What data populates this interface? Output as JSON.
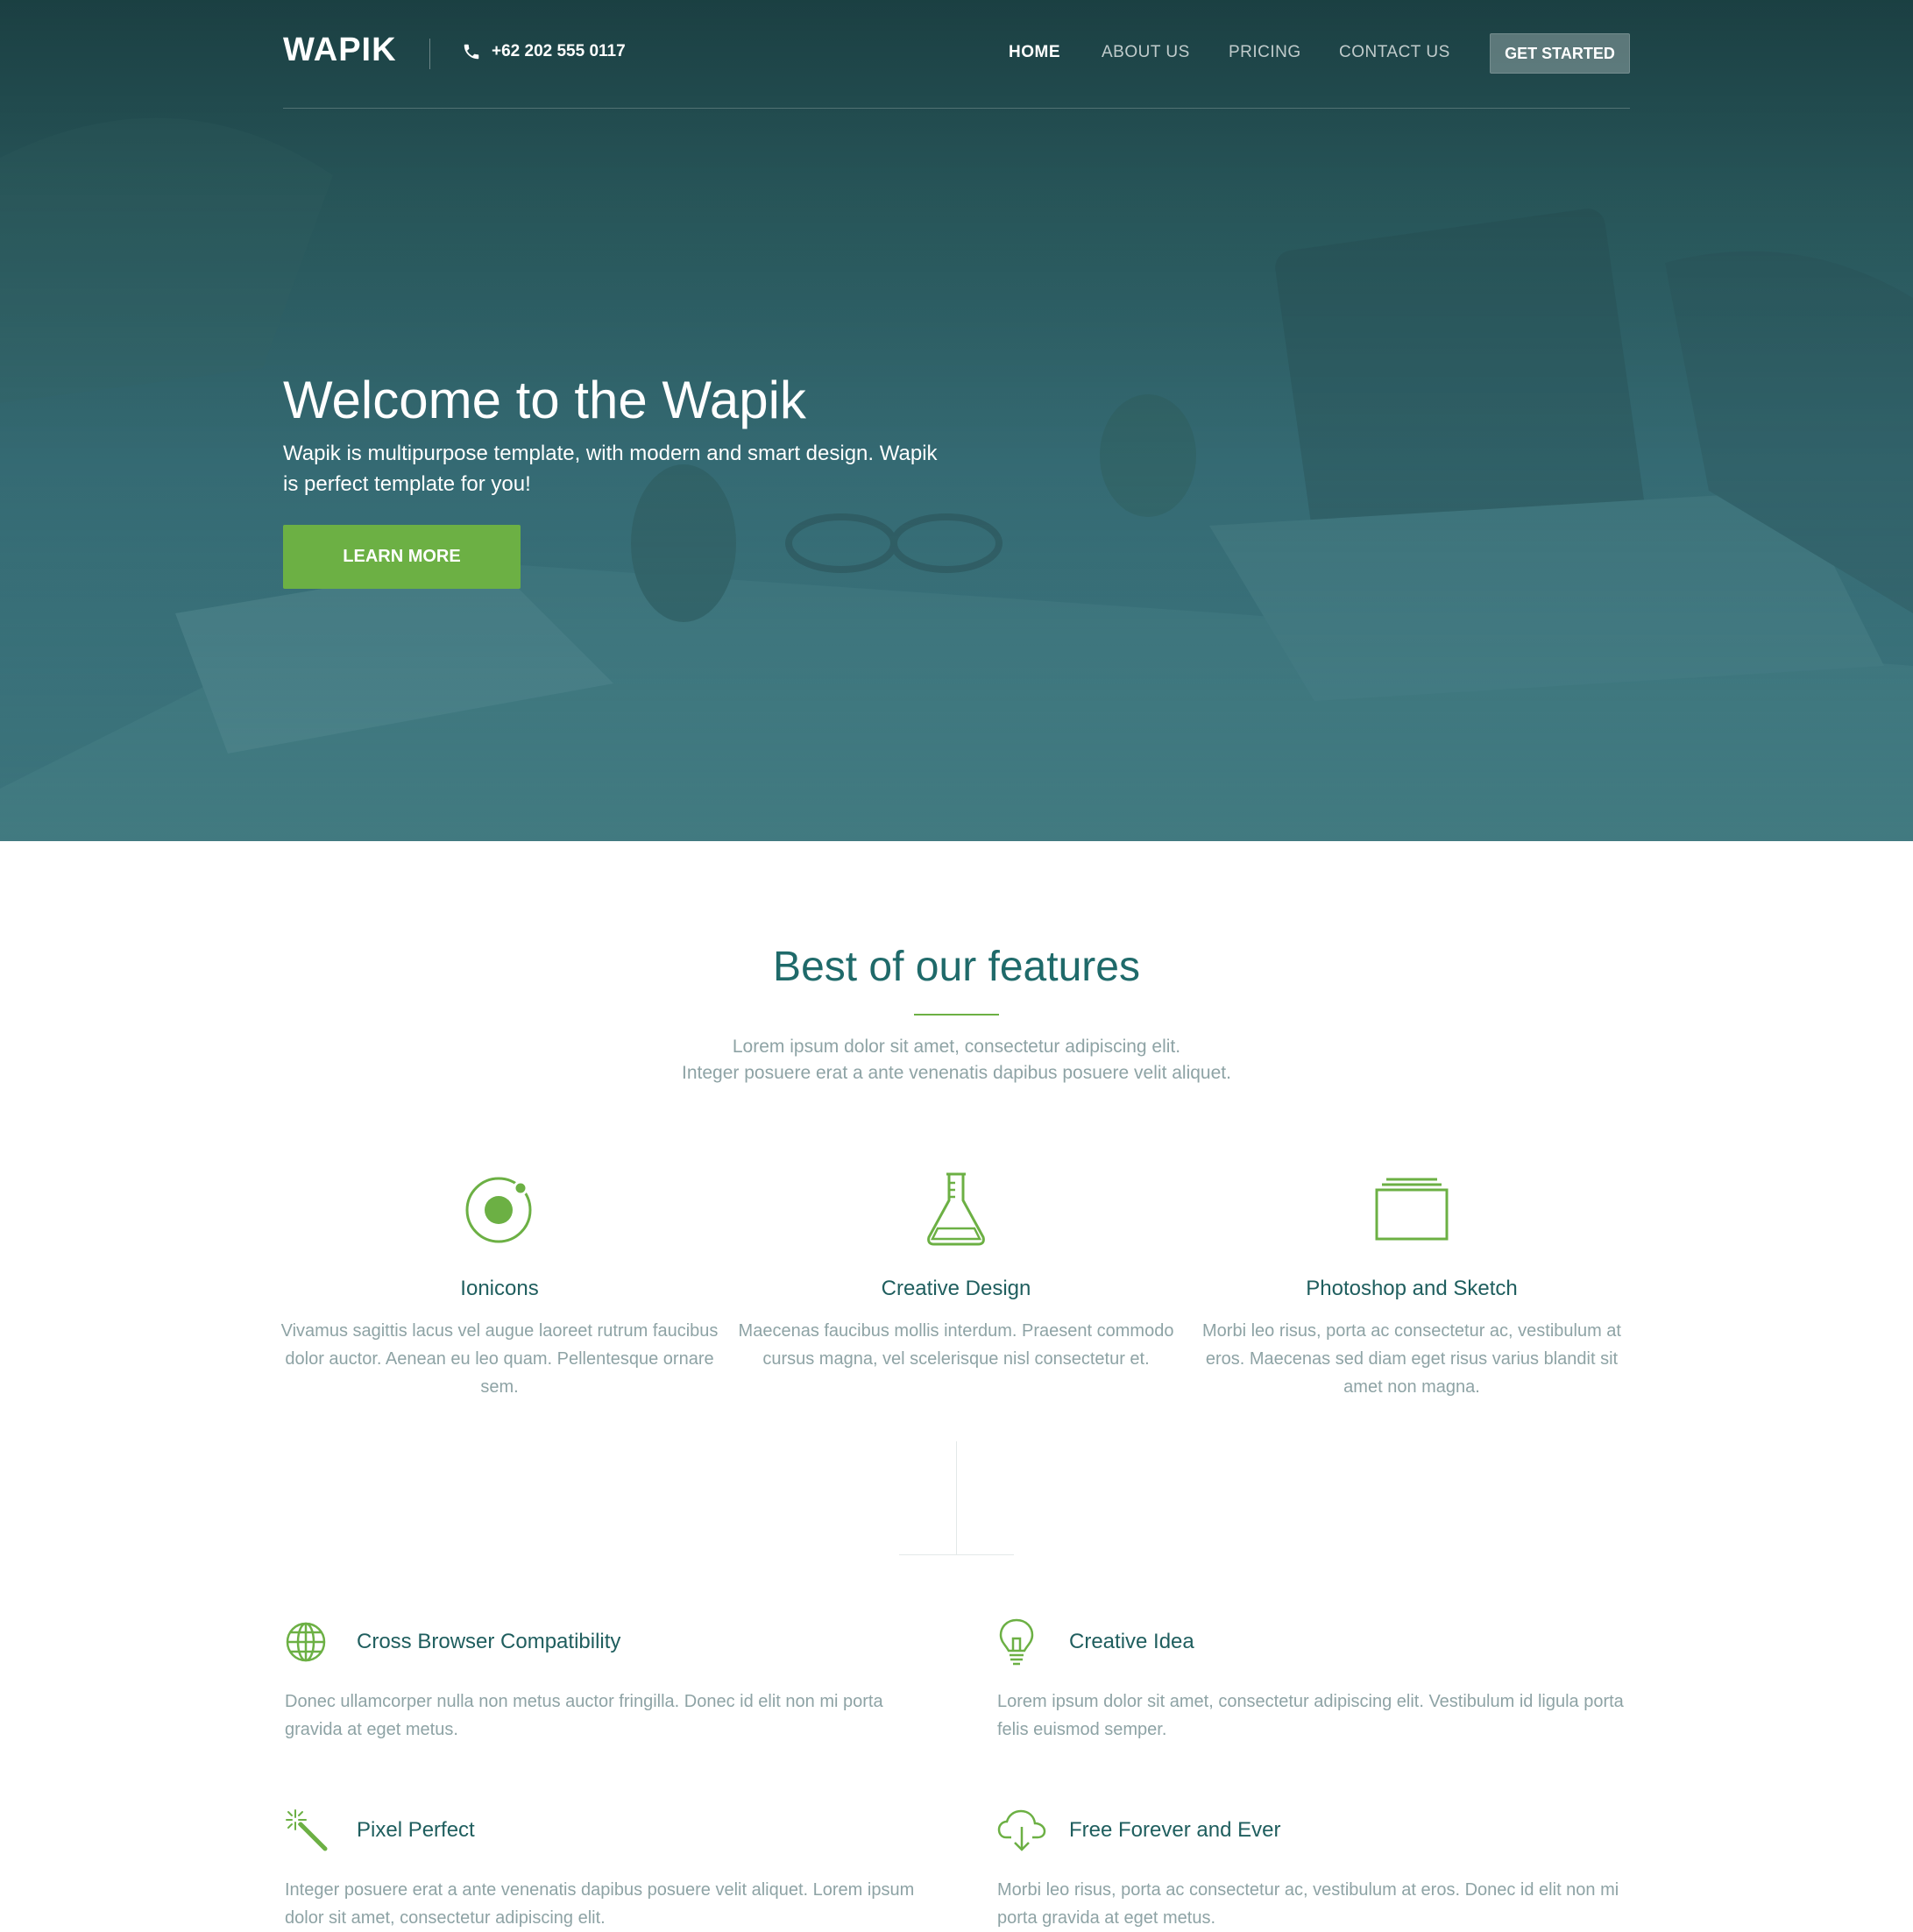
{
  "header": {
    "logo": "WAPIK",
    "phone": "+62 202 555 0117",
    "nav": [
      "HOME",
      "ABOUT US",
      "PRICING",
      "CONTACT US"
    ],
    "cta": "GET STARTED"
  },
  "hero": {
    "title": "Welcome to the Wapik",
    "text": "Wapik is multipurpose template, with modern and smart design. Wapik is perfect template for you!",
    "button": "LEARN MORE"
  },
  "features_section": {
    "title": "Best of our features",
    "subtitle_lines": [
      "Lorem ipsum dolor sit amet, consectetur adipiscing elit.",
      "Integer posuere erat a ante venenatis dapibus posuere velit aliquet."
    ],
    "features": [
      {
        "icon": "ionic-icon",
        "title": "Ionicons",
        "text": "Vivamus sagittis lacus vel augue laoreet rutrum faucibus dolor auctor. Aenean eu leo quam. Pellentesque ornare sem."
      },
      {
        "icon": "flask-icon",
        "title": "Creative Design",
        "text": "Maecenas faucibus mollis interdum. Praesent commodo cursus magna, vel scelerisque nisl consectetur et."
      },
      {
        "icon": "photos-icon",
        "title": "Photoshop and Sketch",
        "text": "Morbi leo risus, porta ac consectetur ac, vestibulum at eros. Maecenas sed diam eget risus varius blandit sit amet non magna."
      }
    ],
    "items": [
      {
        "icon": "globe-icon",
        "title": "Cross Browser Compatibility",
        "text": "Donec ullamcorper nulla non metus auctor fringilla. Donec id elit non mi porta gravida at eget metus."
      },
      {
        "icon": "lightbulb-icon",
        "title": "Creative Idea",
        "text": "Lorem ipsum dolor sit amet, consectetur adipiscing elit. Vestibulum id ligula porta felis euismod semper."
      },
      {
        "icon": "magic-wand-icon",
        "title": "Pixel Perfect",
        "text": "Integer posuere erat a ante venenatis dapibus posuere velit aliquet. Lorem ipsum dolor sit amet, consectetur adipiscing elit."
      },
      {
        "icon": "cloud-download-icon",
        "title": "Free Forever and Ever",
        "text": "Morbi leo risus, porta ac consectetur ac, vestibulum at eros. Donec id elit non mi porta gravida at eget metus."
      }
    ]
  },
  "colors": {
    "accent_green": "#6cb044",
    "heading_teal": "#1f6a6a",
    "muted_text": "#8ea3a5",
    "hero_overlay": "#2f6a70"
  }
}
